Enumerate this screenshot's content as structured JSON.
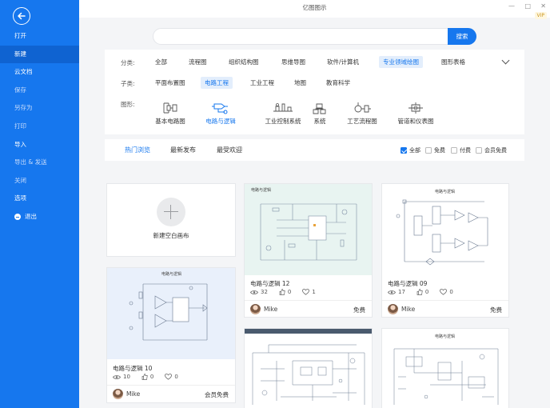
{
  "window": {
    "title": "亿图图示",
    "vip": "VIP",
    "controls": {
      "minimize": "—",
      "maximize": "□",
      "close": "✕"
    }
  },
  "sidebar": {
    "items": [
      {
        "label": "打开",
        "muted": false
      },
      {
        "label": "新建",
        "muted": false,
        "active": true
      },
      {
        "label": "云文档",
        "muted": false
      },
      {
        "label": "保存",
        "muted": true
      },
      {
        "label": "另存为",
        "muted": true
      },
      {
        "label": "打印",
        "muted": true
      },
      {
        "label": "导入",
        "muted": false
      },
      {
        "label": "导出 & 发送",
        "muted": true
      },
      {
        "label": "关闭",
        "muted": true
      },
      {
        "label": "选项",
        "muted": false
      },
      {
        "label": "退出",
        "muted": false
      }
    ]
  },
  "search": {
    "value": "",
    "button": "搜索"
  },
  "filters": {
    "category_label": "分类:",
    "categories": [
      "全部",
      "流程图",
      "组织结构图",
      "思维导图",
      "软件/计算机",
      "专业领域绘图",
      "图形表格"
    ],
    "category_selected": "专业领域绘图",
    "subcategory_label": "子类:",
    "subcategories": [
      "平面布置图",
      "电路工程",
      "工业工程",
      "地图",
      "教育科学"
    ],
    "subcategory_selected": "电路工程",
    "shape_label": "图形:",
    "shapes": [
      "基本电路图",
      "电路与逻辑",
      "工业控制系统",
      "系统",
      "工艺流程图",
      "管道和仪表图"
    ],
    "shape_selected": "电路与逻辑"
  },
  "tabs": {
    "items": [
      "热门浏览",
      "最新发布",
      "最受欢迎"
    ],
    "active": "热门浏览"
  },
  "checkboxes": [
    {
      "label": "全部",
      "checked": true
    },
    {
      "label": "免费",
      "checked": false
    },
    {
      "label": "付费",
      "checked": false
    },
    {
      "label": "会员免费",
      "checked": false
    }
  ],
  "new_card": {
    "label": "新建空白画布"
  },
  "cards": [
    {
      "thumb_title": "电路与逻辑",
      "title": "电路与逻辑 12",
      "views": "32",
      "likes": "0",
      "favorites": "1",
      "author": "Mike",
      "price": "免费"
    },
    {
      "thumb_title": "电路与逻辑",
      "title": "电路与逻辑 09",
      "views": "17",
      "likes": "0",
      "favorites": "0",
      "author": "Mike",
      "price": "免费"
    },
    {
      "thumb_title": "电路与逻辑",
      "title": "电路与逻辑 10",
      "views": "10",
      "likes": "0",
      "favorites": "0",
      "author": "Mike",
      "price": "会员免费"
    },
    {
      "thumb_title": ""
    },
    {
      "thumb_title": "电路与逻辑"
    }
  ]
}
